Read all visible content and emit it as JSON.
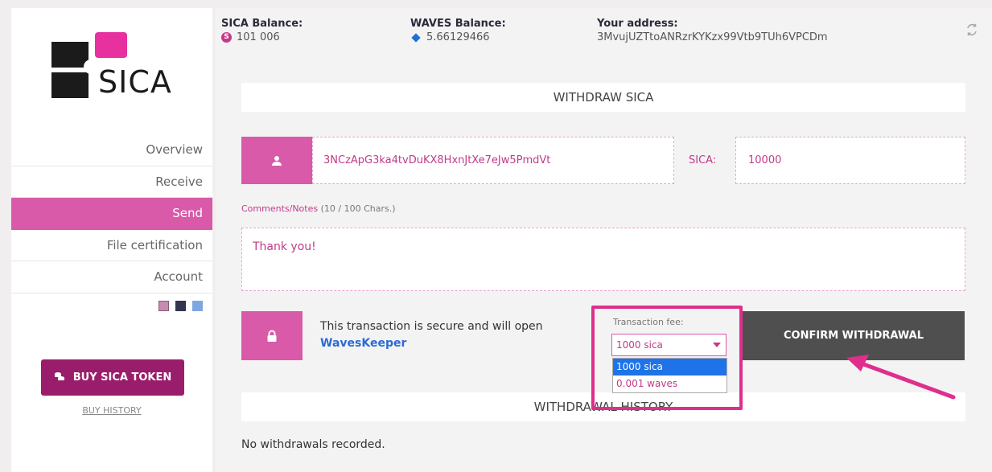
{
  "brand": {
    "name": "SICA"
  },
  "nav": {
    "items": [
      {
        "label": "Overview"
      },
      {
        "label": "Receive"
      },
      {
        "label": "Send"
      },
      {
        "label": "File certification"
      },
      {
        "label": "Account"
      }
    ],
    "active": "Send"
  },
  "swatches": [
    "#c88bb0",
    "#33344f",
    "#7ea6e0"
  ],
  "buy": {
    "button_label": "BUY SICA TOKEN",
    "history_label": "BUY HISTORY"
  },
  "header": {
    "sica_balance_label": "SICA Balance:",
    "sica_balance_value": "101 006",
    "waves_balance_label": "WAVES Balance:",
    "waves_balance_value": "5.66129466",
    "address_label": "Your address:",
    "address_value": "3MvujUZTtoANRzrKYKzx99Vtb9TUh6VPCDm"
  },
  "withdraw": {
    "title": "WITHDRAW SICA",
    "recipient_address": "3NCzApG3ka4tvDuKX8HxnJtXe7eJw5PmdVt",
    "amount_label": "SICA:",
    "amount_value": "10000",
    "comments_label": "Comments/Notes",
    "comments_count": "(10 / 100 Chars.)",
    "notes_value": "Thank you!",
    "secure_text": "This transaction is secure and will open",
    "secure_link": "WavesKeeper",
    "fee_label": "Transaction fee:",
    "fee_selected": "1000 sica",
    "fee_options": [
      "1000 sica",
      "0.001 waves"
    ],
    "confirm_label": "CONFIRM WITHDRAWAL"
  },
  "history": {
    "title": "WITHDRAWAL HISTORY",
    "empty_text": "No withdrawals recorded."
  },
  "colors": {
    "accent": "#d85aa8",
    "brand_dark": "#9a1d6b",
    "highlight": "#de2f8d"
  }
}
